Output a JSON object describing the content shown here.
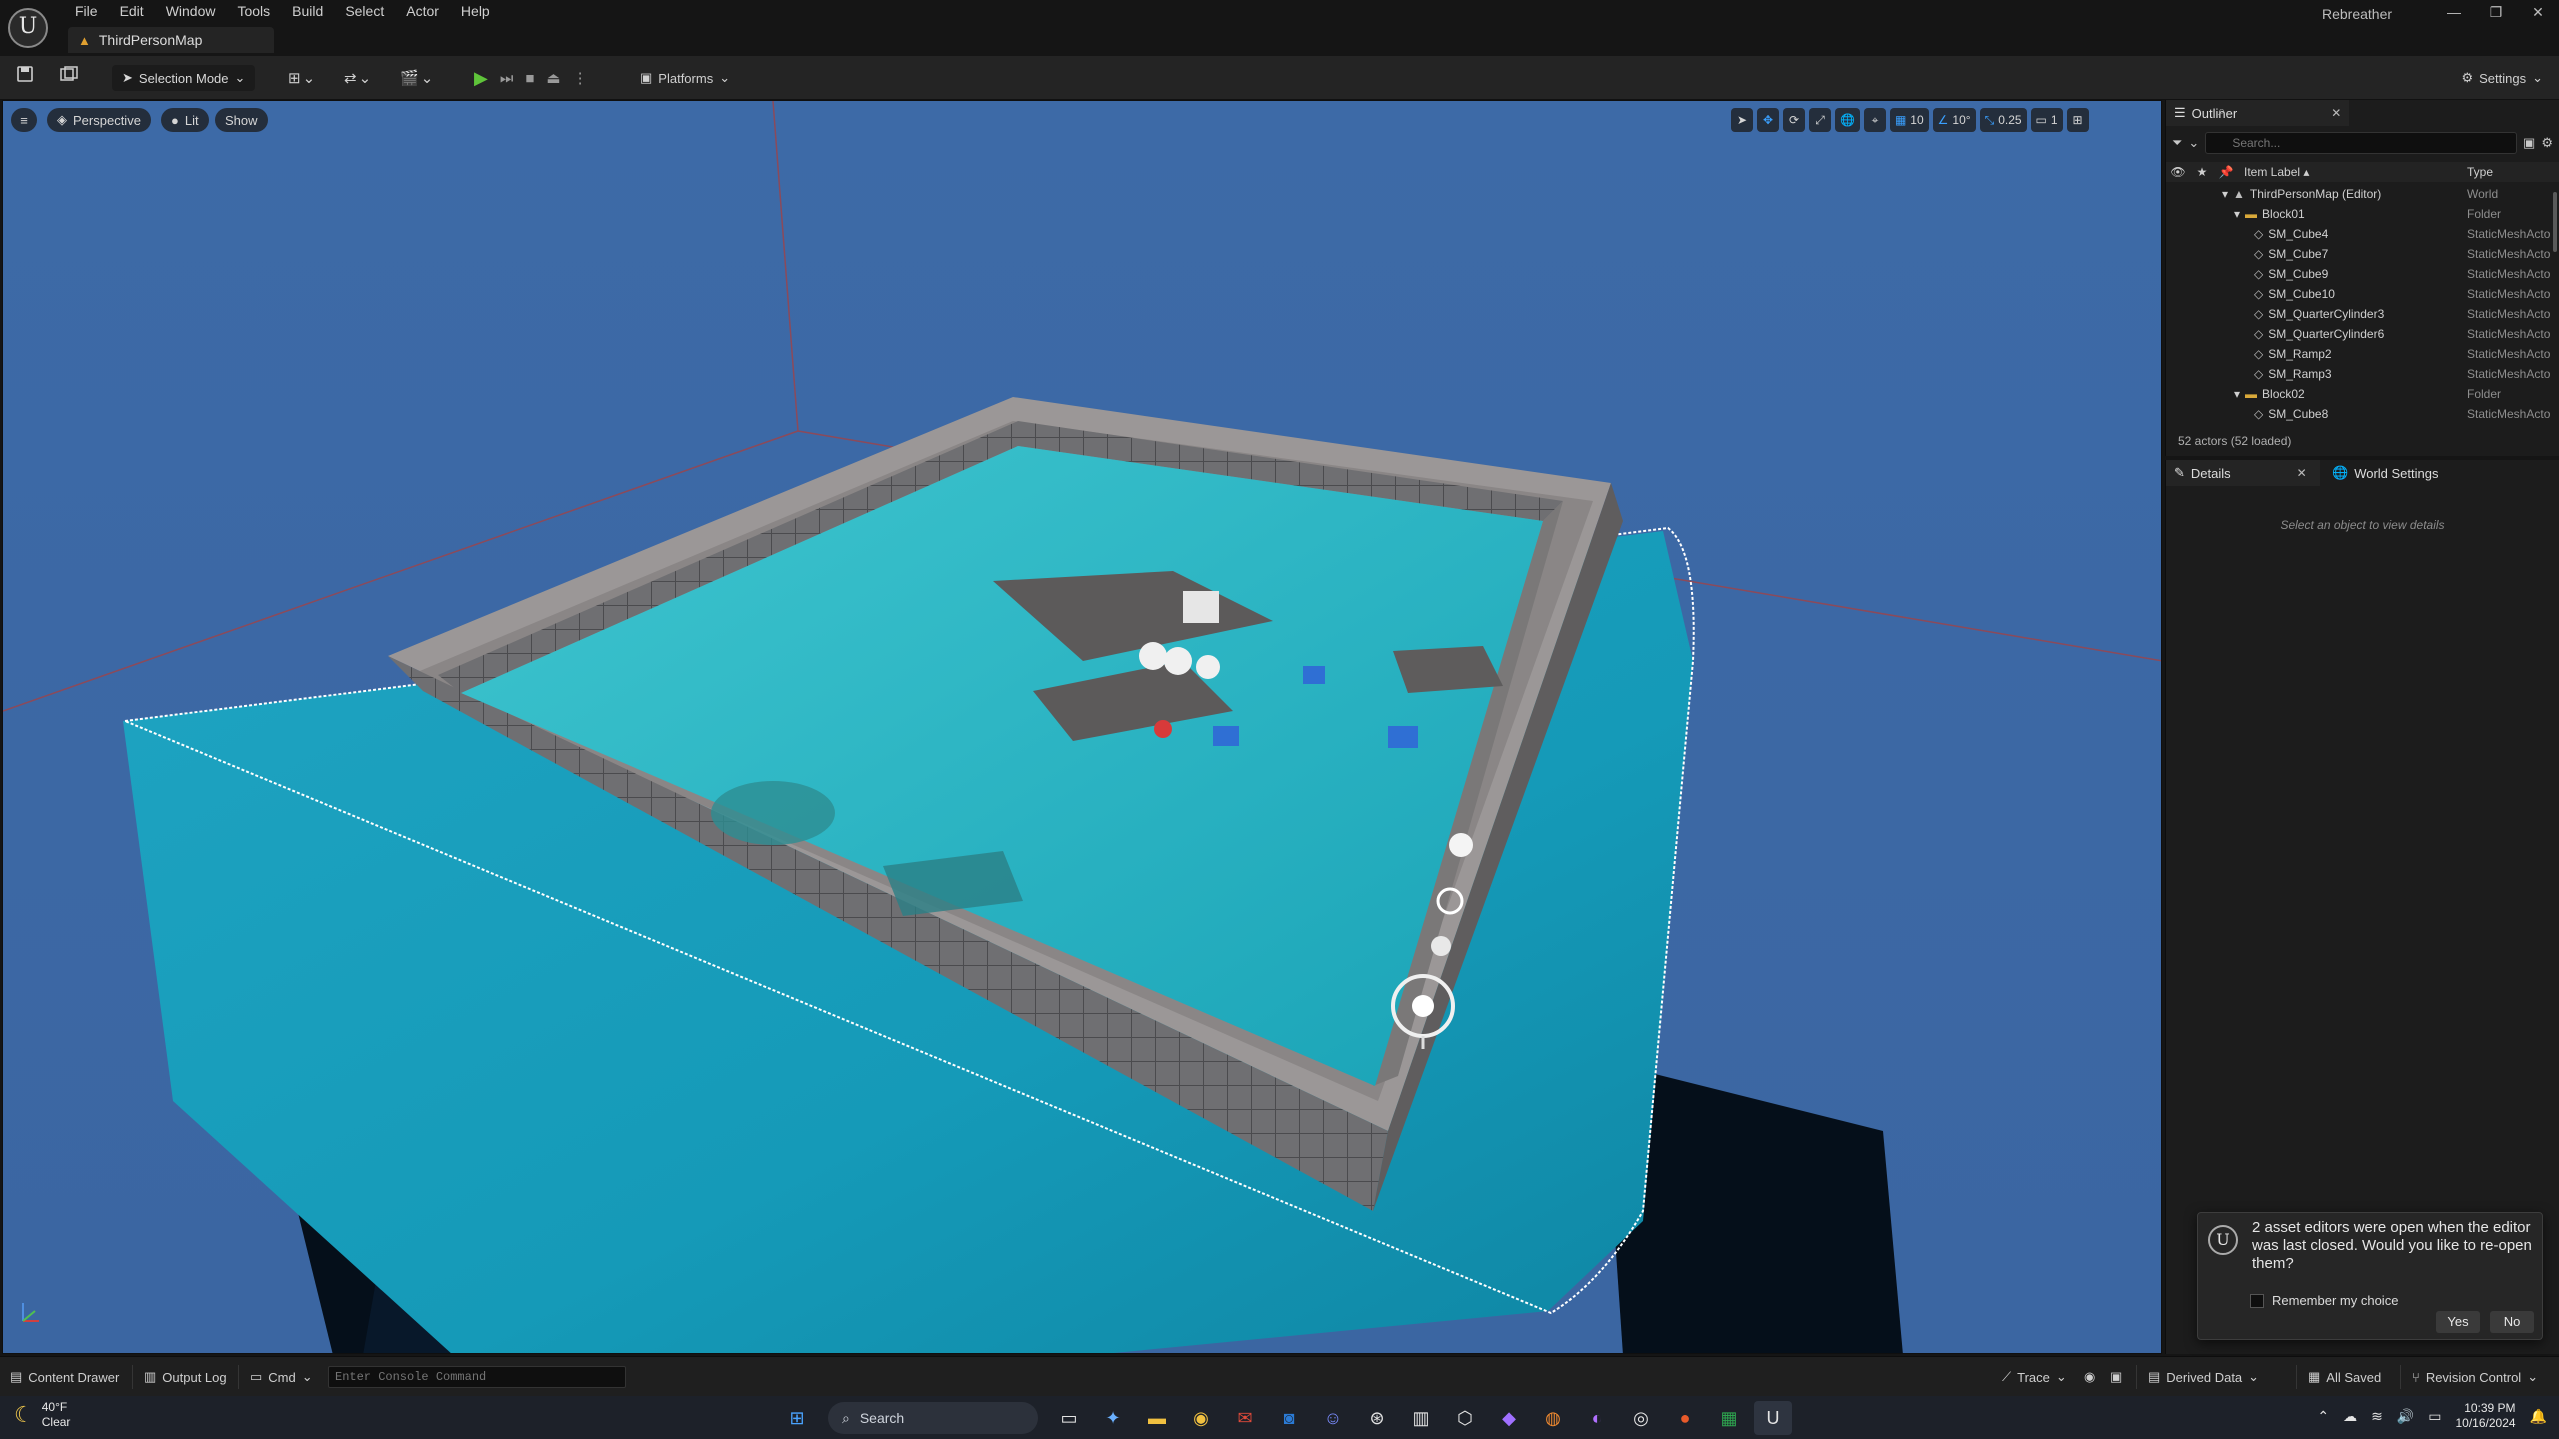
{
  "app": {
    "name": "Rebreather",
    "map_tab": "ThirdPersonMap",
    "menu": [
      "File",
      "Edit",
      "Window",
      "Tools",
      "Build",
      "Select",
      "Actor",
      "Help"
    ],
    "window_controls": [
      "—",
      "❐",
      "✕"
    ]
  },
  "toolbar": {
    "selection_mode": "Selection Mode",
    "platforms": "Platforms",
    "settings": "Settings"
  },
  "viewport": {
    "perspective": "Perspective",
    "lit": "Lit",
    "show": "Show",
    "grid_snap": "10",
    "rotation_snap": "10°",
    "scale_snap": "0.25",
    "camera_speed": "1"
  },
  "outliner": {
    "title": "Outliner",
    "search_placeholder": "Search...",
    "col_label": "Item Label ▴",
    "col_type": "Type",
    "rows": [
      {
        "label": "ThirdPersonMap (Editor)",
        "type": "World",
        "kind": "world"
      },
      {
        "label": "Block01",
        "type": "Folder",
        "kind": "folder"
      },
      {
        "label": "SM_Cube4",
        "type": "StaticMeshActor",
        "kind": "mesh"
      },
      {
        "label": "SM_Cube7",
        "type": "StaticMeshActor",
        "kind": "mesh"
      },
      {
        "label": "SM_Cube9",
        "type": "StaticMeshActor",
        "kind": "mesh"
      },
      {
        "label": "SM_Cube10",
        "type": "StaticMeshActor",
        "kind": "mesh"
      },
      {
        "label": "SM_QuarterCylinder3",
        "type": "StaticMeshActor",
        "kind": "mesh"
      },
      {
        "label": "SM_QuarterCylinder6",
        "type": "StaticMeshActor",
        "kind": "mesh"
      },
      {
        "label": "SM_Ramp2",
        "type": "StaticMeshActor",
        "kind": "mesh"
      },
      {
        "label": "SM_Ramp3",
        "type": "StaticMeshActor",
        "kind": "mesh"
      },
      {
        "label": "Block02",
        "type": "Folder",
        "kind": "folder"
      },
      {
        "label": "SM_Cube8",
        "type": "StaticMeshActor",
        "kind": "mesh"
      }
    ],
    "footer": "52 actors (52 loaded)"
  },
  "details": {
    "title": "Details",
    "world_settings": "World Settings",
    "empty": "Select an object to view details"
  },
  "notification": {
    "message": "2 asset editors were open when the editor was last closed. Would you like to re-open them?",
    "remember": "Remember my choice",
    "yes": "Yes",
    "no": "No"
  },
  "statusbar": {
    "content_drawer": "Content Drawer",
    "output_log": "Output Log",
    "cmd": "Cmd",
    "console_placeholder": "Enter Console Command",
    "trace": "Trace",
    "derived_data": "Derived Data",
    "all_saved": "All Saved",
    "revision_control": "Revision Control"
  },
  "taskbar": {
    "temperature": "40°F",
    "condition": "Clear",
    "search": "Search",
    "time": "10:39 PM",
    "date": "10/16/2024"
  }
}
